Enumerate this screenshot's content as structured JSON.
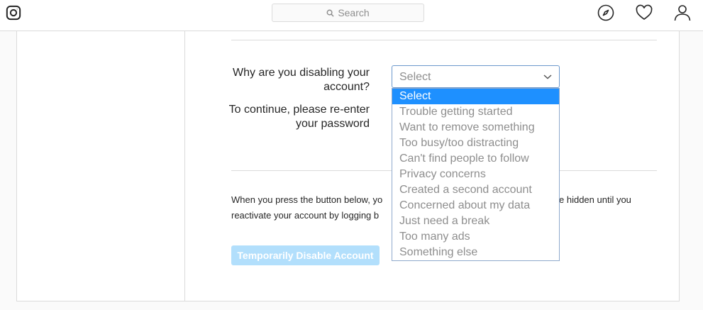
{
  "header": {
    "logo_icon": "instagram-icon",
    "search": {
      "placeholder": "Search"
    },
    "nav_icons": [
      "compass-icon",
      "heart-icon",
      "person-icon"
    ]
  },
  "form": {
    "reason_label": "Why are you disabling your account?",
    "password_label": "To continue, please re-enter your password",
    "select": {
      "value": "Select",
      "options": [
        "Select",
        "Trouble getting started",
        "Want to remove something",
        "Too busy/too distracting",
        "Can't find people to follow",
        "Privacy concerns",
        "Created a second account",
        "Concerned about my data",
        "Just need a break",
        "Too many ads",
        "Something else"
      ],
      "highlighted": "Select"
    }
  },
  "notice": {
    "line1_start": "When you press the button below, yo",
    "line1_end": "e hidden until you",
    "line2_start": "reactivate your account by logging b"
  },
  "actions": {
    "disable_label": "Temporarily Disable Account"
  },
  "colors": {
    "accent": "#1e90ff",
    "button_disabled": "#b2dffc",
    "border": "#dbdbdb"
  }
}
